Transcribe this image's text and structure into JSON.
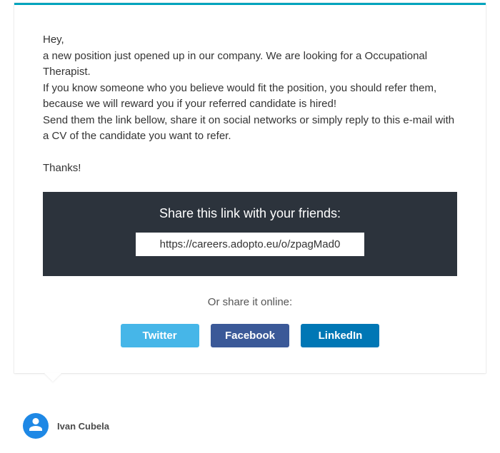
{
  "message": {
    "greeting": "Hey,",
    "line2": "a new position just opened up in our company. We are looking for a Occupational Therapist.",
    "line3": "If you know someone who you believe would fit the position, you should refer them, because we will reward you if your referred candidate is hired!",
    "line4": "Send them the link bellow, share it on social networks or simply reply to this e-mail with a CV of the candidate you want to refer.",
    "thanks": "Thanks!"
  },
  "share": {
    "box_title": "Share this link with your friends:",
    "url": "https://careers.adopto.eu/o/zpagMad0",
    "or_text": "Or share it online:",
    "buttons": {
      "twitter": "Twitter",
      "facebook": "Facebook",
      "linkedin": "LinkedIn"
    }
  },
  "author": {
    "name": "Ivan Cubela"
  },
  "colors": {
    "accent": "#00a4bd",
    "dark_box": "#2c333c",
    "twitter": "#46b6e8",
    "facebook": "#3b5998",
    "linkedin": "#0077b5"
  }
}
